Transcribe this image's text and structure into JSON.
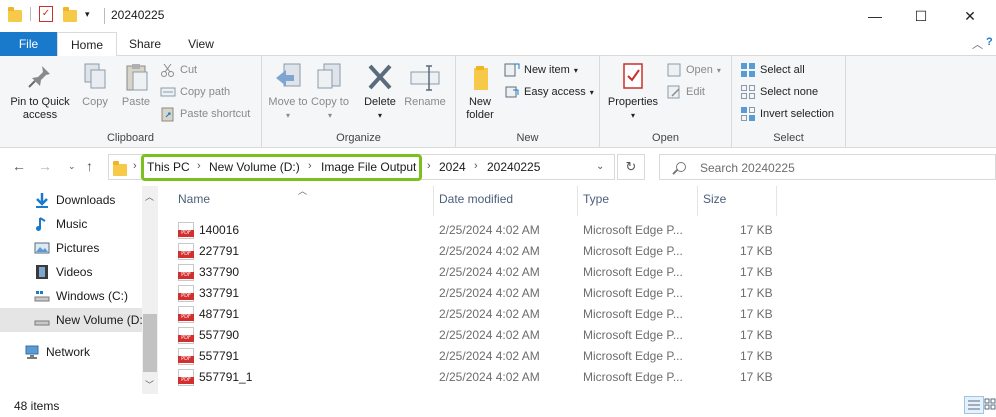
{
  "window": {
    "title": "20240225",
    "controls": {
      "minimize": "—",
      "maximize": "☐",
      "close": "✕"
    }
  },
  "tabs": {
    "file": "File",
    "home": "Home",
    "share": "Share",
    "view": "View"
  },
  "ribbon": {
    "clipboard": {
      "label": "Clipboard",
      "pin": "Pin to Quick access",
      "copy": "Copy",
      "paste": "Paste",
      "cut": "Cut",
      "copy_path": "Copy path",
      "paste_shortcut": "Paste shortcut"
    },
    "organize": {
      "label": "Organize",
      "move_to": "Move to",
      "copy_to": "Copy to",
      "delete": "Delete",
      "rename": "Rename"
    },
    "new": {
      "label": "New",
      "new_folder": "New folder",
      "new_item": "New item",
      "easy_access": "Easy access"
    },
    "open": {
      "label": "Open",
      "properties": "Properties",
      "open": "Open",
      "edit": "Edit"
    },
    "select": {
      "label": "Select",
      "select_all": "Select all",
      "select_none": "Select none",
      "invert_selection": "Invert selection"
    }
  },
  "address": {
    "crumbs": [
      "This PC",
      "New Volume (D:)",
      "Image File Output",
      "2024",
      "20240225"
    ],
    "search_placeholder": "Search 20240225"
  },
  "nav_pane": {
    "items": [
      {
        "label": "Downloads",
        "icon": "download-icon"
      },
      {
        "label": "Music",
        "icon": "music-icon"
      },
      {
        "label": "Pictures",
        "icon": "pictures-icon"
      },
      {
        "label": "Videos",
        "icon": "videos-icon"
      },
      {
        "label": "Windows (C:)",
        "icon": "drive-icon"
      },
      {
        "label": "New Volume (D:)",
        "icon": "drive-icon",
        "selected": true
      },
      {
        "label": "Network",
        "icon": "network-icon"
      }
    ]
  },
  "file_list": {
    "columns": {
      "name": "Name",
      "date": "Date modified",
      "type": "Type",
      "size": "Size"
    },
    "rows": [
      {
        "name": "140016",
        "date": "2/25/2024 4:02 AM",
        "type": "Microsoft Edge P...",
        "size": "17 KB"
      },
      {
        "name": "227791",
        "date": "2/25/2024 4:02 AM",
        "type": "Microsoft Edge P...",
        "size": "17 KB"
      },
      {
        "name": "337790",
        "date": "2/25/2024 4:02 AM",
        "type": "Microsoft Edge P...",
        "size": "17 KB"
      },
      {
        "name": "337791",
        "date": "2/25/2024 4:02 AM",
        "type": "Microsoft Edge P...",
        "size": "17 KB"
      },
      {
        "name": "487791",
        "date": "2/25/2024 4:02 AM",
        "type": "Microsoft Edge P...",
        "size": "17 KB"
      },
      {
        "name": "557790",
        "date": "2/25/2024 4:02 AM",
        "type": "Microsoft Edge P...",
        "size": "17 KB"
      },
      {
        "name": "557791",
        "date": "2/25/2024 4:02 AM",
        "type": "Microsoft Edge P...",
        "size": "17 KB"
      },
      {
        "name": "557791_1",
        "date": "2/25/2024 4:02 AM",
        "type": "Microsoft Edge P...",
        "size": "17 KB"
      }
    ]
  },
  "status": {
    "items_count": "48 items"
  },
  "colors": {
    "accent": "#1979ca",
    "highlight": "#7cc01f",
    "pdf": "#d32f2f"
  }
}
